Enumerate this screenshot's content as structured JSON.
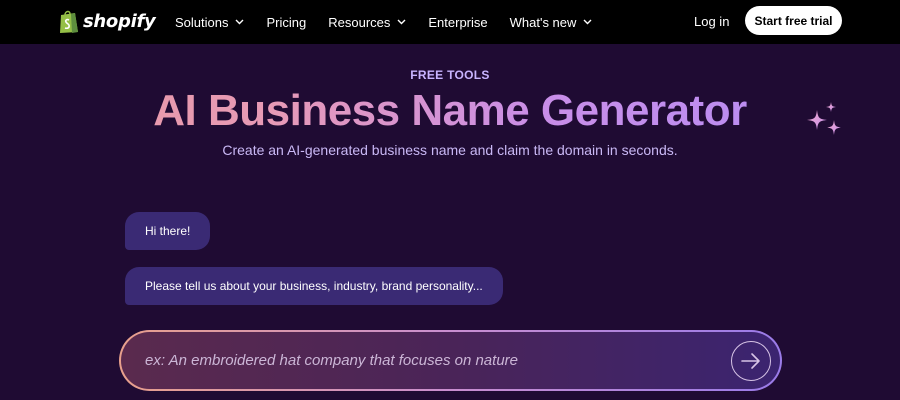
{
  "nav": {
    "logo_text": "shopify",
    "items": [
      {
        "label": "Solutions",
        "has_dropdown": true
      },
      {
        "label": "Pricing",
        "has_dropdown": false
      },
      {
        "label": "Resources",
        "has_dropdown": true
      },
      {
        "label": "Enterprise",
        "has_dropdown": false
      },
      {
        "label": "What's new",
        "has_dropdown": true
      }
    ],
    "login_label": "Log in",
    "cta_label": "Start free trial"
  },
  "hero": {
    "eyebrow": "FREE TOOLS",
    "title": "AI Business Name Generator",
    "subtitle": "Create an AI-generated business name and claim the domain in seconds.",
    "sparkle_icon": "sparkle-icon"
  },
  "chat": {
    "messages": [
      {
        "text": "Hi there!"
      },
      {
        "text": "Please tell us about your business, industry, brand personality..."
      }
    ]
  },
  "input": {
    "value": "",
    "placeholder": "ex: An embroidered hat company that focuses on nature",
    "send_icon": "arrow-right-icon"
  },
  "colors": {
    "nav_bg": "#000000",
    "page_bg": "#1f0b33",
    "bubble_bg": "#3a2a74",
    "accent": "#c8b4ff"
  }
}
